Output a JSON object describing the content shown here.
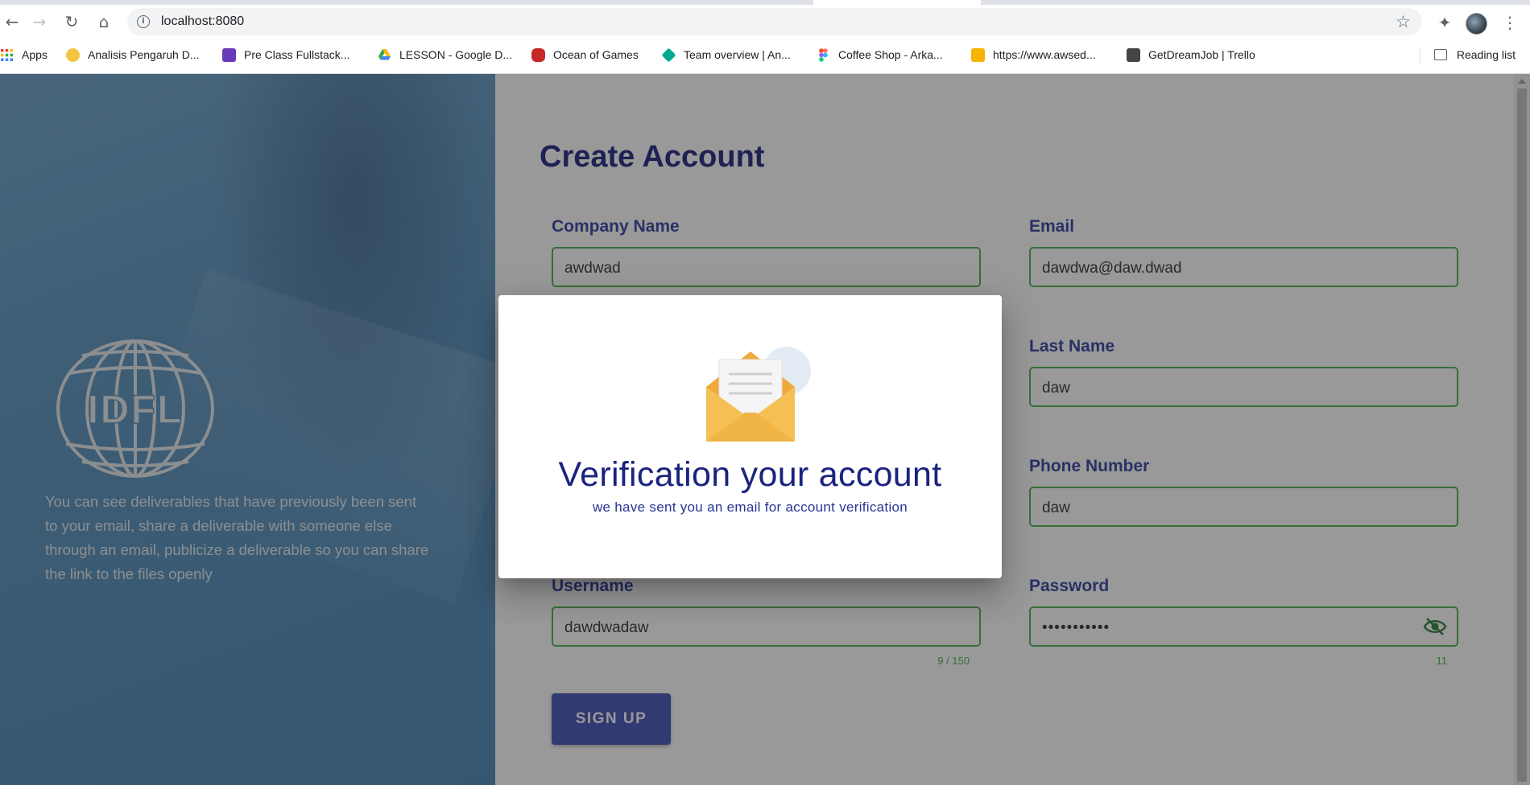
{
  "browser": {
    "url": "localhost:8080",
    "bookmarks": [
      {
        "label": "Apps",
        "color": "#ea4335"
      },
      {
        "label": "Analisis Pengaruh D...",
        "color": "#f4c542"
      },
      {
        "label": "Pre Class Fullstack...",
        "color": "#673ab7"
      },
      {
        "label": "LESSON - Google D...",
        "color": "#1a73e8"
      },
      {
        "label": "Ocean of Games",
        "color": "#c62828"
      },
      {
        "label": "Team overview | An...",
        "color": "#00a98f"
      },
      {
        "label": "Coffee Shop - Arka...",
        "color": "#f24e1e"
      },
      {
        "label": "https://www.awsed...",
        "color": "#f5b400"
      },
      {
        "label": "GetDreamJob | Trello",
        "color": "#444444"
      }
    ],
    "reading_list": "Reading list"
  },
  "left_panel": {
    "logo_text": "IDFL",
    "description": "You can see deliverables that have previously been sent to your email, share a deliverable with someone else through an email, publicize a deliverable so you can share the link to the files openly"
  },
  "form": {
    "title": "Create Account",
    "company_name": {
      "label": "Company Name",
      "value": "awdwad"
    },
    "email": {
      "label": "Email",
      "value": "dawdwa@daw.dwad"
    },
    "last_name": {
      "label": "Last Name",
      "value": "daw"
    },
    "phone_number": {
      "label": "Phone Number",
      "value": "daw"
    },
    "username": {
      "label": "Username",
      "value": "dawdwadaw",
      "counter": "9 / 150"
    },
    "password": {
      "label": "Password",
      "value": "•••••••••••",
      "counter": "11"
    },
    "signup_label": "SIGN UP"
  },
  "dialog": {
    "title": "Verification your account",
    "subtitle": "we have sent you an email for account verification"
  },
  "colors": {
    "primary": "#3f51b5",
    "title": "#1a237e",
    "field_border": "#4caf50",
    "left_panel": "#4a86b6"
  }
}
